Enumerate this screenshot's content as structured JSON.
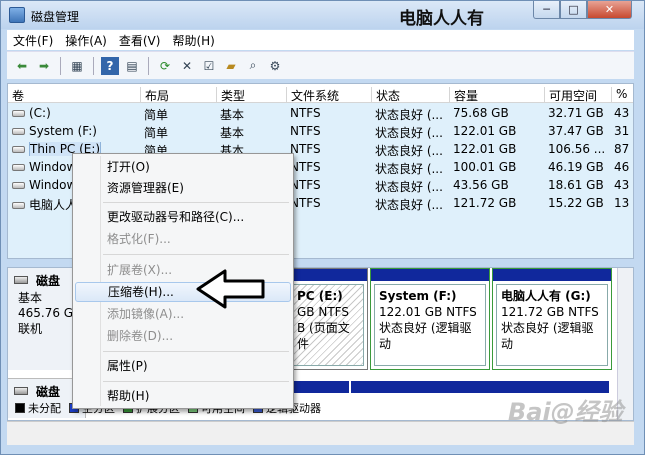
{
  "window": {
    "title": "磁盘管理",
    "watermark": "电脑人人有"
  },
  "title_buttons": {
    "minimize": "─",
    "maximize": "□",
    "close": "✕"
  },
  "menu": [
    "文件(F)",
    "操作(A)",
    "查看(V)",
    "帮助(H)"
  ],
  "toolbar_icons": [
    "back-icon",
    "forward-icon",
    "properties-icon",
    "help-icon",
    "console-icon",
    "refresh-icon",
    "delete-icon",
    "check-icon",
    "open-icon",
    "search-icon",
    "settings-icon"
  ],
  "table": {
    "headers": [
      "卷",
      "布局",
      "类型",
      "文件系统",
      "状态",
      "容量",
      "可用空间",
      "%"
    ],
    "rows": [
      [
        "(C:)",
        "简单",
        "基本",
        "NTFS",
        "状态良好 (...",
        "75.68 GB",
        "32.71 GB",
        "43"
      ],
      [
        "System (F:)",
        "简单",
        "基本",
        "NTFS",
        "状态良好 (...",
        "122.01 GB",
        "37.47 GB",
        "31"
      ],
      [
        "Thin PC (E:)",
        "简单",
        "基本",
        "NTFS",
        "状态良好 (...",
        "122.01 GB",
        "106.56 ...",
        "87"
      ],
      [
        "Windows",
        "简单",
        "基本",
        "NTFS",
        "状态良好 (...",
        "100.01 GB",
        "46.19 GB",
        "46"
      ],
      [
        "Windows",
        "简单",
        "基本",
        "NTFS",
        "状态良好 (...",
        "43.56 GB",
        "18.61 GB",
        "43"
      ],
      [
        "电脑人人",
        "简单",
        "基本",
        "NTFS",
        "状态良好 (...",
        "121.72 GB",
        "15.22 GB",
        "13"
      ]
    ]
  },
  "disk0": {
    "name": "磁盘",
    "type": "基本",
    "size": "465.76 G",
    "status": "联机"
  },
  "partitions": [
    {
      "name": "PC  (E:)",
      "size": "GB NTFS",
      "status": "B (页面文件"
    },
    {
      "name": "System  (F:)",
      "size": "122.01 GB NTFS",
      "status": "状态良好 (逻辑驱动"
    },
    {
      "name": "电脑人人有  (G:)",
      "size": "121.72 GB NTFS",
      "status": "状态良好 (逻辑驱动"
    }
  ],
  "disk1": {
    "name": "磁盘"
  },
  "legend": [
    {
      "label": "未分配",
      "color": "#000000"
    },
    {
      "label": "主分区",
      "color": "#1c3ec8"
    },
    {
      "label": "扩展分区",
      "color": "#3a9a3a"
    },
    {
      "label": "可用空间",
      "color": "#7fd07f"
    },
    {
      "label": "逻辑驱动器",
      "color": "#3b5cd6"
    }
  ],
  "context_menu": [
    {
      "label": "打开(O)",
      "enabled": true
    },
    {
      "label": "资源管理器(E)",
      "enabled": true
    },
    {
      "label": "更改驱动器号和路径(C)...",
      "enabled": true
    },
    {
      "label": "格式化(F)...",
      "enabled": false
    },
    {
      "label": "扩展卷(X)...",
      "enabled": false
    },
    {
      "label": "压缩卷(H)...",
      "enabled": true
    },
    {
      "label": "添加镜像(A)...",
      "enabled": false
    },
    {
      "label": "删除卷(D)...",
      "enabled": false
    },
    {
      "label": "属性(P)",
      "enabled": true
    },
    {
      "label": "帮助(H)",
      "enabled": true
    }
  ],
  "baidu_watermark": "Bai@经验"
}
